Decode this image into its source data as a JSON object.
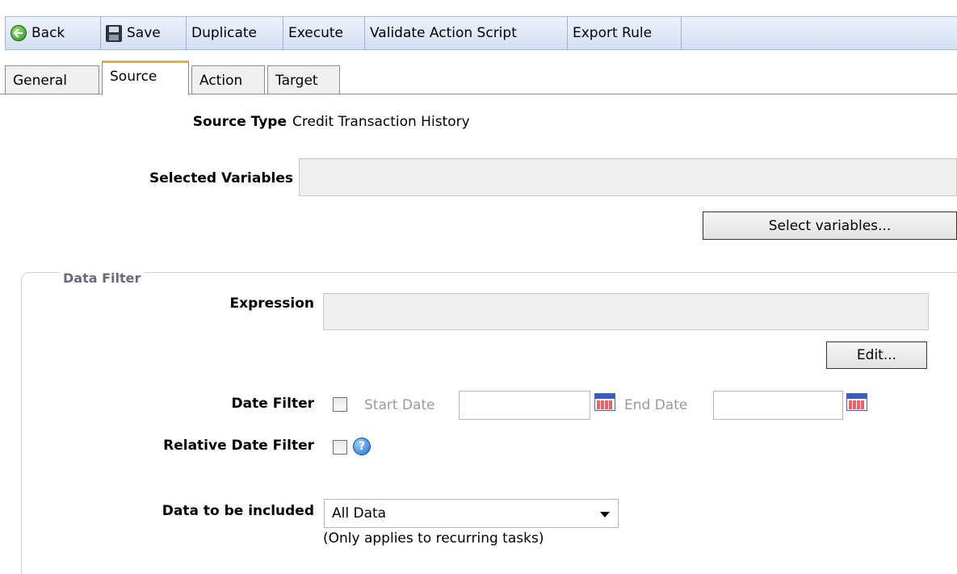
{
  "toolbar": {
    "back": "Back",
    "save": "Save",
    "duplicate": "Duplicate",
    "execute": "Execute",
    "validate": "Validate Action Script",
    "export": "Export Rule"
  },
  "tabs": {
    "general": "General",
    "source": "Source",
    "action": "Action",
    "target": "Target",
    "active": "Source"
  },
  "source": {
    "source_type_label": "Source Type",
    "source_type_value": "Credit Transaction History",
    "selected_variables_label": "Selected Variables",
    "selected_variables_value": "",
    "select_variables_button": "Select variables..."
  },
  "data_filter": {
    "legend": "Data Filter",
    "expression_label": "Expression",
    "expression_value": "",
    "edit_button": "Edit...",
    "date_filter_label": "Date Filter",
    "start_date_label": "Start Date",
    "start_date_value": "",
    "end_date_label": "End Date",
    "end_date_value": "",
    "relative_date_filter_label": "Relative Date Filter",
    "help_glyph": "?",
    "data_included_label": "Data to be included",
    "data_included_value": "All Data",
    "note": "(Only applies to recurring tasks)"
  },
  "colors": {
    "toolbar_top": "#eef3fb",
    "toolbar_bottom": "#d3e0f3",
    "active_tab_accent": "#f2a93b",
    "legend_text": "#6a6a7a"
  }
}
